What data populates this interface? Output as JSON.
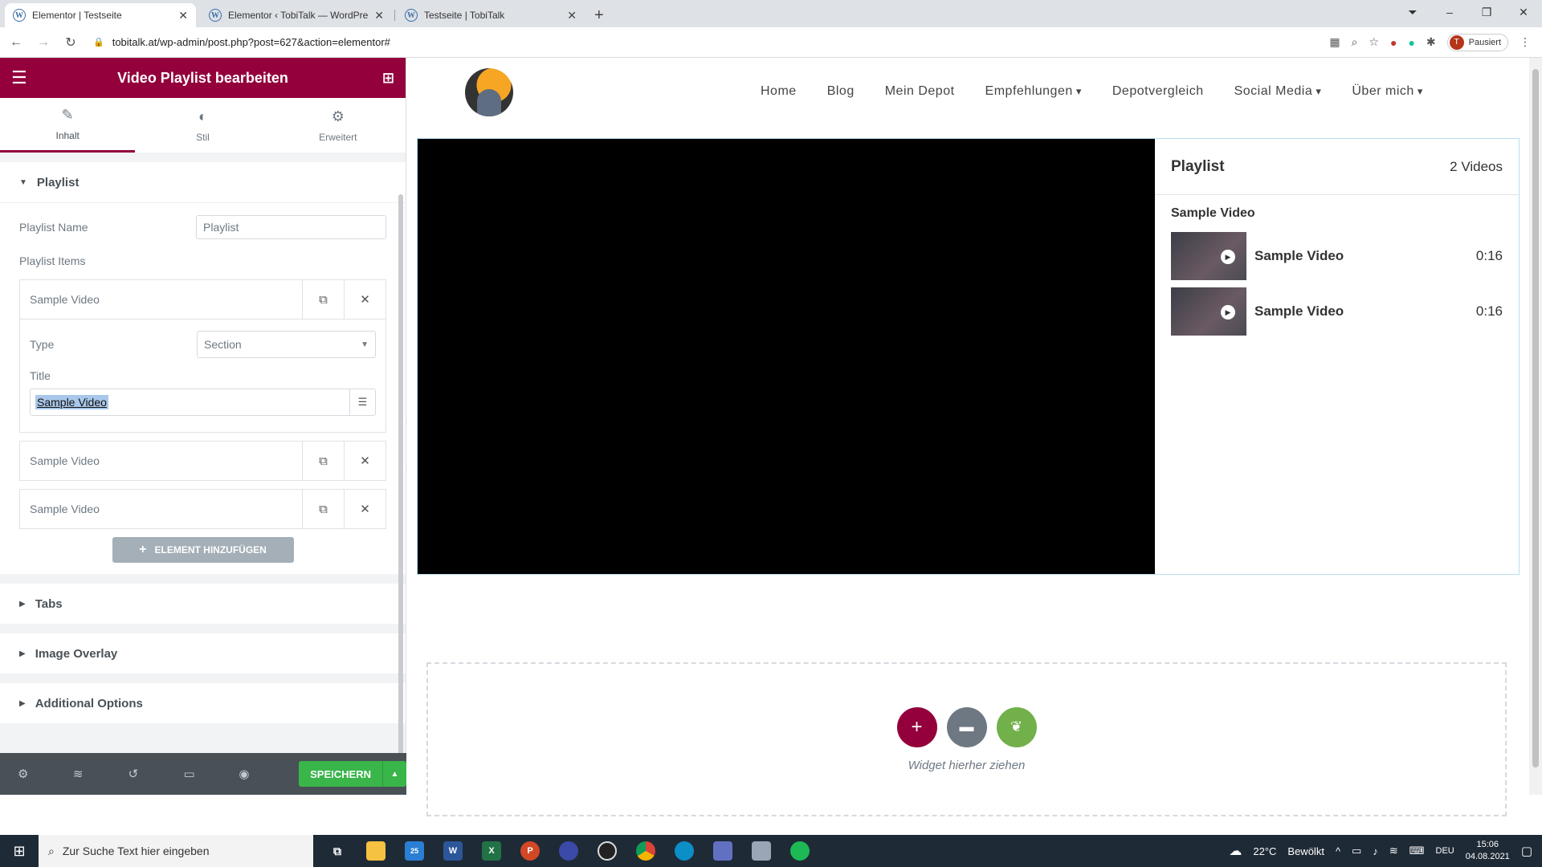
{
  "browser": {
    "tabs": [
      {
        "title": "Elementor | Testseite",
        "active": true
      },
      {
        "title": "Elementor ‹ TobiTalk — WordPre",
        "active": false
      },
      {
        "title": "Testseite | TobiTalk",
        "active": false
      }
    ],
    "url": "tobitalk.at/wp-admin/post.php?post=627&action=elementor#",
    "profile_label": "Pausiert",
    "profile_initial": "T"
  },
  "panel": {
    "title": "Video Playlist bearbeiten",
    "tabs": [
      "Inhalt",
      "Stil",
      "Erweitert"
    ],
    "playlist_section": "Playlist",
    "playlist_name_label": "Playlist Name",
    "playlist_name_value": "Playlist",
    "playlist_items_label": "Playlist Items",
    "items": [
      {
        "title": "Sample Video"
      },
      {
        "title": "Sample Video"
      },
      {
        "title": "Sample Video"
      }
    ],
    "type_label": "Type",
    "type_value": "Section",
    "title_label": "Title",
    "title_value": "Sample Video",
    "add_button": "ELEMENT HINZUFÜGEN",
    "sections": [
      "Tabs",
      "Image Overlay",
      "Additional Options"
    ],
    "save_button": "SPEICHERN"
  },
  "site": {
    "nav": [
      "Home",
      "Blog",
      "Mein Depot",
      "Empfehlungen",
      "Depotvergleich",
      "Social Media",
      "Über mich"
    ],
    "playlist": {
      "name": "Playlist",
      "count": "2 Videos",
      "section_title": "Sample Video",
      "videos": [
        {
          "title": "Sample Video",
          "duration": "0:16"
        },
        {
          "title": "Sample Video",
          "duration": "0:16"
        }
      ]
    },
    "dropzone_text": "Widget hierher ziehen"
  },
  "taskbar": {
    "search_placeholder": "Zur Suche Text hier eingeben",
    "weather": "22°C",
    "weather_text": "Bewölkt",
    "lang": "DEU",
    "time": "15:06",
    "date": "04.08.2021",
    "mail_badge": "25"
  },
  "colors": {
    "elementor_brand": "#93003c",
    "save_green": "#39b54a"
  }
}
